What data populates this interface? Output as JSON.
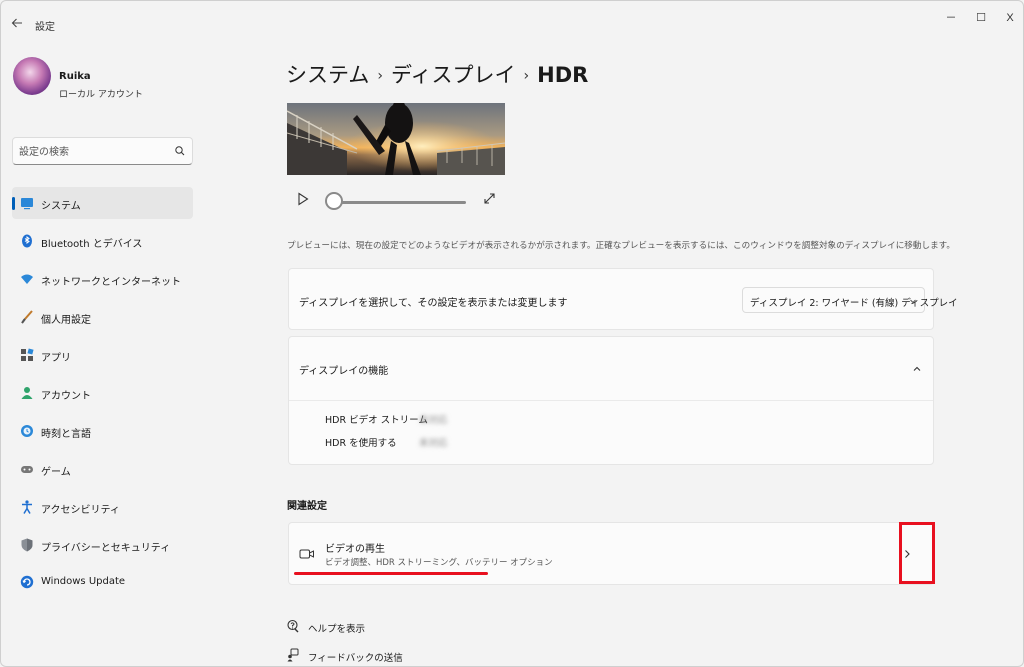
{
  "window": {
    "title": "設定",
    "controls": {
      "minimize": "－",
      "maximize": "☐",
      "close": "X"
    }
  },
  "profile": {
    "name": "Ruika",
    "account_type": "ローカル アカウント"
  },
  "search": {
    "placeholder": "設定の検索"
  },
  "sidebar": {
    "items": [
      {
        "label": "システム",
        "icon": "system-icon",
        "selected": true
      },
      {
        "label": "Bluetooth とデバイス",
        "icon": "bluetooth-icon"
      },
      {
        "label": "ネットワークとインターネット",
        "icon": "network-icon"
      },
      {
        "label": "個人用設定",
        "icon": "brush-icon"
      },
      {
        "label": "アプリ",
        "icon": "apps-icon"
      },
      {
        "label": "アカウント",
        "icon": "account-icon"
      },
      {
        "label": "時刻と言語",
        "icon": "time-language-icon"
      },
      {
        "label": "ゲーム",
        "icon": "gaming-icon"
      },
      {
        "label": "アクセシビリティ",
        "icon": "accessibility-icon"
      },
      {
        "label": "プライバシーとセキュリティ",
        "icon": "shield-icon"
      },
      {
        "label": "Windows Update",
        "icon": "windows-update-icon"
      }
    ]
  },
  "breadcrumb": {
    "items": [
      "システム",
      "ディスプレイ",
      "HDR"
    ],
    "separator": "›"
  },
  "preview": {
    "description": "プレビューには、現在の設定でどのようなビデオが表示されるかが示されます。正確なプレビューを表示するには、このウィンドウを調整対象のディスプレイに移動します。",
    "progress": 0
  },
  "display_select": {
    "label": "ディスプレイを選択して、その設定を表示または変更します",
    "value": "ディスプレイ 2: ワイヤード (有線) ディスプレイ"
  },
  "display_features": {
    "title": "ディスプレイの機能",
    "rows": [
      {
        "name": "HDR ビデオ ストリーム",
        "value": "未対応"
      },
      {
        "name": "HDR を使用する",
        "value": "未対応"
      }
    ]
  },
  "related": {
    "heading": "関連設定",
    "video_playback": {
      "title": "ビデオの再生",
      "subtitle": "ビデオ調整、HDR ストリーミング、バッテリー オプション"
    }
  },
  "links": {
    "help": "ヘルプを表示",
    "feedback": "フィードバックの送信"
  },
  "colors": {
    "accent": "#005fb8",
    "annotation_red": "#e8101f",
    "background": "#f3f3f3",
    "card": "#fbfbfb"
  }
}
